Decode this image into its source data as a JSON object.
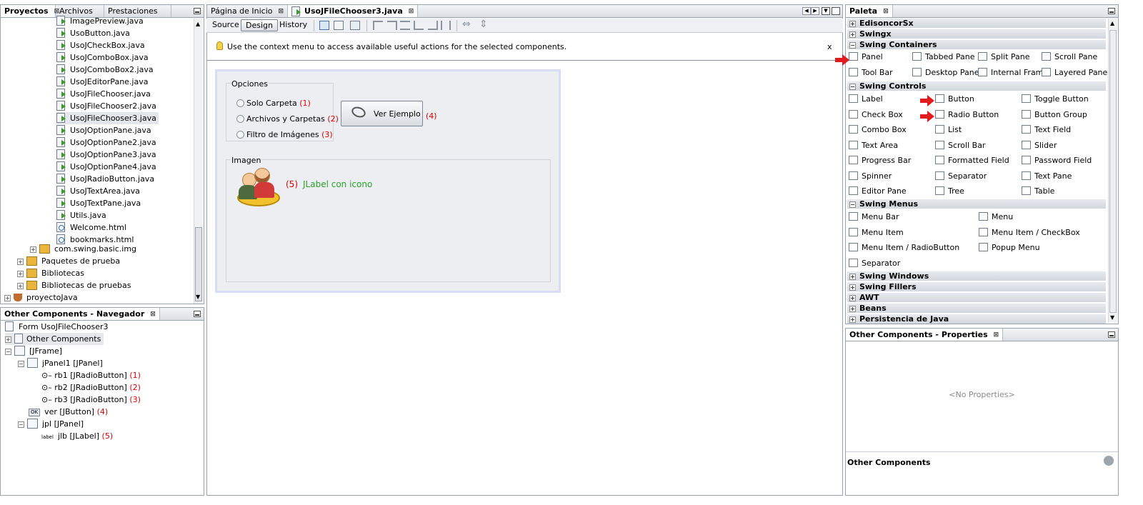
{
  "projects_panel": {
    "tabs": [
      "Proyectos",
      "Archivos",
      "Prestaciones"
    ],
    "files": [
      {
        "name": "ImagePreview.java",
        "kind": "java"
      },
      {
        "name": "UsoButton.java",
        "kind": "java"
      },
      {
        "name": "UsoJCheckBox.java",
        "kind": "java"
      },
      {
        "name": "UsoJComboBox.java",
        "kind": "java"
      },
      {
        "name": "UsoJComboBox2.java",
        "kind": "java"
      },
      {
        "name": "UsoJEditorPane.java",
        "kind": "java"
      },
      {
        "name": "UsoJFileChooser.java",
        "kind": "java"
      },
      {
        "name": "UsoJFileChooser2.java",
        "kind": "java"
      },
      {
        "name": "UsoJFileChooser3.java",
        "kind": "java"
      },
      {
        "name": "UsoJOptionPane.java",
        "kind": "java"
      },
      {
        "name": "UsoJOptionPane2.java",
        "kind": "java"
      },
      {
        "name": "UsoJOptionPane3.java",
        "kind": "java"
      },
      {
        "name": "UsoJOptionPane4.java",
        "kind": "java"
      },
      {
        "name": "UsoJRadioButton.java",
        "kind": "java"
      },
      {
        "name": "UsoJTextArea.java",
        "kind": "java"
      },
      {
        "name": "UsoJTextPane.java",
        "kind": "java"
      },
      {
        "name": "Utils.java",
        "kind": "java"
      },
      {
        "name": "Welcome.html",
        "kind": "html"
      },
      {
        "name": "bookmarks.html",
        "kind": "html"
      }
    ],
    "package": "com.swing.basic.img",
    "nodes": [
      "Paquetes de prueba",
      "Bibliotecas",
      "Bibliotecas de pruebas"
    ],
    "project": "proyectoJava"
  },
  "navigator": {
    "title": "Other Components - Navegador",
    "form": "Form UsoJFileChooser3",
    "other": "Other Components",
    "frame": "[JFrame]",
    "jpanel1": "jPanel1 [JPanel]",
    "rb1": "rb1 [JRadioButton]",
    "rb2": "rb2 [JRadioButton]",
    "rb3": "rb3 [JRadioButton]",
    "ver": "ver [JButton]",
    "jpl": "jpl [JPanel]",
    "jlb": "jlb [JLabel]",
    "n1": "(1)",
    "n2": "(2)",
    "n3": "(3)",
    "n4": "(4)",
    "n5": "(5)",
    "ok_icon": "OK",
    "label_icon": "label"
  },
  "editor": {
    "tabs": [
      "Página de Inicio",
      "UsoJFileChooser3.java"
    ],
    "views": [
      "Source",
      "Design",
      "History"
    ],
    "hint": "Use the context menu to access available useful actions for the selected components.",
    "hint_close": "x",
    "form": {
      "opciones_title": "Opciones",
      "radios": [
        "Solo Carpeta",
        "Archivos y Carpetas",
        "Filtro de Imágenes"
      ],
      "radio_nums": [
        "(1)",
        "(2)",
        "(3)"
      ],
      "button_label": "Ver Ejemplo",
      "button_num": "(4)",
      "imagen_title": "Imagen",
      "label_num": "(5)",
      "label_text": "JLabel con  icono"
    }
  },
  "palette": {
    "title": "Paleta",
    "cats_top": [
      "EdisoncorSx",
      "Swingx",
      "Swing Containers"
    ],
    "containers": [
      "Panel",
      "Tabbed Pane",
      "Split Pane",
      "Scroll Pane",
      "Tool Bar",
      "Desktop Pane",
      "Internal Frame",
      "Layered Pane"
    ],
    "controls_title": "Swing Controls",
    "controls": [
      "Label",
      "Button",
      "Toggle Button",
      "Check Box",
      "Radio Button",
      "Button Group",
      "Combo Box",
      "List",
      "Text Field",
      "Text Area",
      "Scroll Bar",
      "Slider",
      "Progress Bar",
      "Formatted Field",
      "Password Field",
      "Spinner",
      "Separator",
      "Text Pane",
      "Editor Pane",
      "Tree",
      "Table"
    ],
    "menus_title": "Swing Menus",
    "menus": [
      "Menu Bar",
      "Menu",
      "Menu Item",
      "Menu Item / CheckBox",
      "Menu Item / RadioButton",
      "Popup Menu",
      "Separator"
    ],
    "cats_bottom": [
      "Swing Windows",
      "Swing Fillers",
      "AWT",
      "Beans",
      "Persistencia de Java"
    ]
  },
  "properties": {
    "title": "Other Components - Properties",
    "empty": "<No Properties>",
    "footer": "Other Components"
  }
}
